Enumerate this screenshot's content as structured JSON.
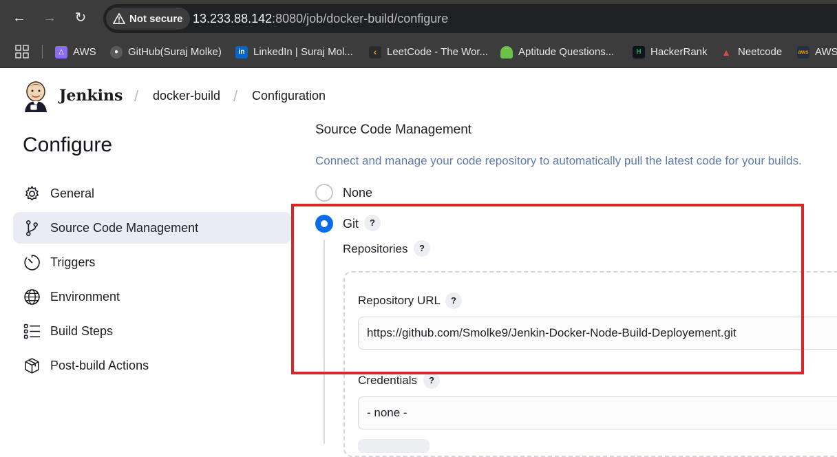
{
  "browser": {
    "security_label": "Not secure",
    "url_host": "13.233.88.142",
    "url_rest": ":8080/job/docker-build/configure",
    "bookmarks": [
      {
        "label": "AWS",
        "icon": "aws-cube-icon",
        "color": "#8c6cf0"
      },
      {
        "label": "GitHub(Suraj Molke)",
        "icon": "github-icon",
        "color": "#2b2b2b"
      },
      {
        "label": "LinkedIn | Suraj Mol...",
        "icon": "linkedin-icon",
        "color": "#0a66c2"
      },
      {
        "label": "LeetCode - The Wor...",
        "icon": "leetcode-icon",
        "color": "#f0a21a"
      },
      {
        "label": "Aptitude Questions...",
        "icon": "tree-icon",
        "color": "#6cc04a"
      },
      {
        "label": "HackerRank",
        "icon": "hackerrank-icon",
        "color": "#1ba94c"
      },
      {
        "label": "Neetcode",
        "icon": "rocket-icon",
        "color": "#e04848"
      },
      {
        "label": "AWS",
        "icon": "aws-logo-icon",
        "color": "#232f3e"
      }
    ]
  },
  "header": {
    "app_name": "Jenkins",
    "breadcrumbs": [
      "docker-build",
      "Configuration"
    ]
  },
  "sidebar": {
    "title": "Configure",
    "items": [
      {
        "label": "General",
        "icon": "gear-icon",
        "active": false
      },
      {
        "label": "Source Code Management",
        "icon": "branch-icon",
        "active": true
      },
      {
        "label": "Triggers",
        "icon": "timer-icon",
        "active": false
      },
      {
        "label": "Environment",
        "icon": "globe-icon",
        "active": false
      },
      {
        "label": "Build Steps",
        "icon": "list-icon",
        "active": false
      },
      {
        "label": "Post-build Actions",
        "icon": "package-icon",
        "active": false
      }
    ]
  },
  "scm": {
    "title": "Source Code Management",
    "description": "Connect and manage your code repository to automatically pull the latest code for your builds.",
    "options": [
      {
        "label": "None",
        "selected": false
      },
      {
        "label": "Git",
        "selected": true
      }
    ],
    "help_glyph": "?",
    "repositories_label": "Repositories",
    "repo_url_label": "Repository URL",
    "repo_url_value": "https://github.com/Smolke9/Jenkin-Docker-Node-Build-Deployement.git",
    "credentials_label": "Credentials",
    "credentials_value": "- none -"
  },
  "colors": {
    "accent": "#0b6ce8",
    "highlight": "#d62828",
    "description": "#5e7bad"
  }
}
